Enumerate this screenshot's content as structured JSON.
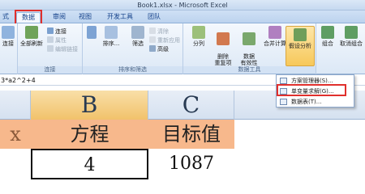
{
  "window": {
    "title": "Book1.xlsx - Microsoft Excel"
  },
  "tabs": [
    {
      "label": "式"
    },
    {
      "label": "数据"
    },
    {
      "label": "审阅"
    },
    {
      "label": "视图"
    },
    {
      "label": "开发工具"
    },
    {
      "label": "团队"
    }
  ],
  "ribbon": {
    "connections": {
      "label": "连接",
      "refresh_all": "全部刷新",
      "connections": "连接",
      "properties": "属性",
      "edit_links": "编辑链接",
      "partial_left": "连接"
    },
    "sort_filter": {
      "label": "排序和筛选",
      "sort": "排序...",
      "filter": "筛选",
      "clear": "清除",
      "reapply": "重新应用",
      "advanced": "高级"
    },
    "data_tools": {
      "label": "数据工具",
      "text_to_columns": "分列",
      "remove_duplicates": "删除\n重复项",
      "data_validation": "数据\n有效性",
      "consolidate": "合并计算",
      "what_if": "假设分析"
    },
    "outline": {
      "group": "组合",
      "ungroup": "取消组合"
    }
  },
  "formula_bar": {
    "content": "3*a2^2+4"
  },
  "columns": [
    {
      "label": "B"
    },
    {
      "label": "C"
    }
  ],
  "cells": {
    "a1_partial": "x",
    "b1": "方程",
    "c1": "目标值",
    "b2": "4",
    "c2": "1087"
  },
  "what_if_menu": [
    {
      "label": "方案管理器(S)..."
    },
    {
      "label": "单变量求解(G)..."
    },
    {
      "label": "数据表(T)..."
    }
  ],
  "colors": {
    "highlight": "#e0302d",
    "header_fill": "#f7b88c",
    "selected_column": "#f1c26b"
  }
}
